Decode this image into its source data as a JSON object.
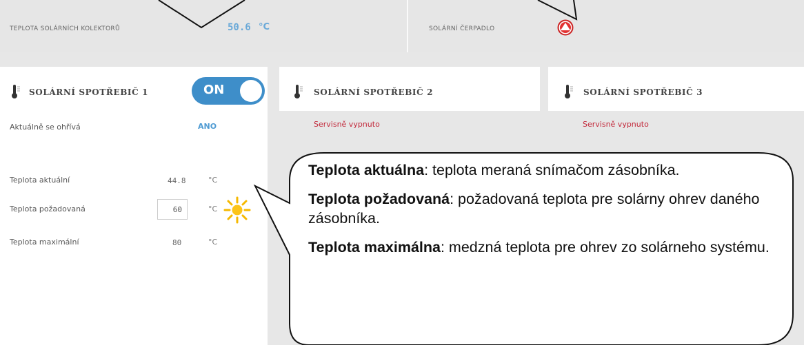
{
  "topbar": {
    "collector_label": "TEPLOTA SOLÁRNÍCH KOLEKTORŮ",
    "collector_value": "50.6",
    "collector_unit": "°C",
    "pump_label": "SOLÁRNÍ ČERPADLO",
    "pump_icon": "pump-running-icon"
  },
  "panels": [
    {
      "title": "SOLÁRNÍ SPOTŘEBIČ 1",
      "toggle": "ON",
      "heating_label": "Aktuálně se ohřívá",
      "heating_value": "ANO",
      "rows": [
        {
          "label": "Teplota aktuální",
          "value": "44.8",
          "unit": "°C"
        },
        {
          "label": "Teplota požadovaná",
          "value": "60",
          "unit": "°C"
        },
        {
          "label": "Teplota maximální",
          "value": "80",
          "unit": "°C"
        }
      ]
    },
    {
      "title": "SOLÁRNÍ SPOTŘEBIČ 2",
      "status": "Servisně vypnuto"
    },
    {
      "title": "SOLÁRNÍ SPOTŘEBIČ 3",
      "status": "Servisně vypnuto"
    }
  ],
  "callout": [
    {
      "term": "Teplota aktuálna",
      "text": ": teplota meraná snímačom zásobníka."
    },
    {
      "term": "Teplota požadovaná",
      "text": ": požadovaná teplota pre solárny ohrev daného zásobníka."
    },
    {
      "term": "Teplota maximálna",
      "text": ": medzná teplota pre ohrev zo solárneho systému."
    }
  ],
  "colors": {
    "accent": "#3e8ec9",
    "warning": "#c2283a",
    "pump": "#e23232"
  }
}
